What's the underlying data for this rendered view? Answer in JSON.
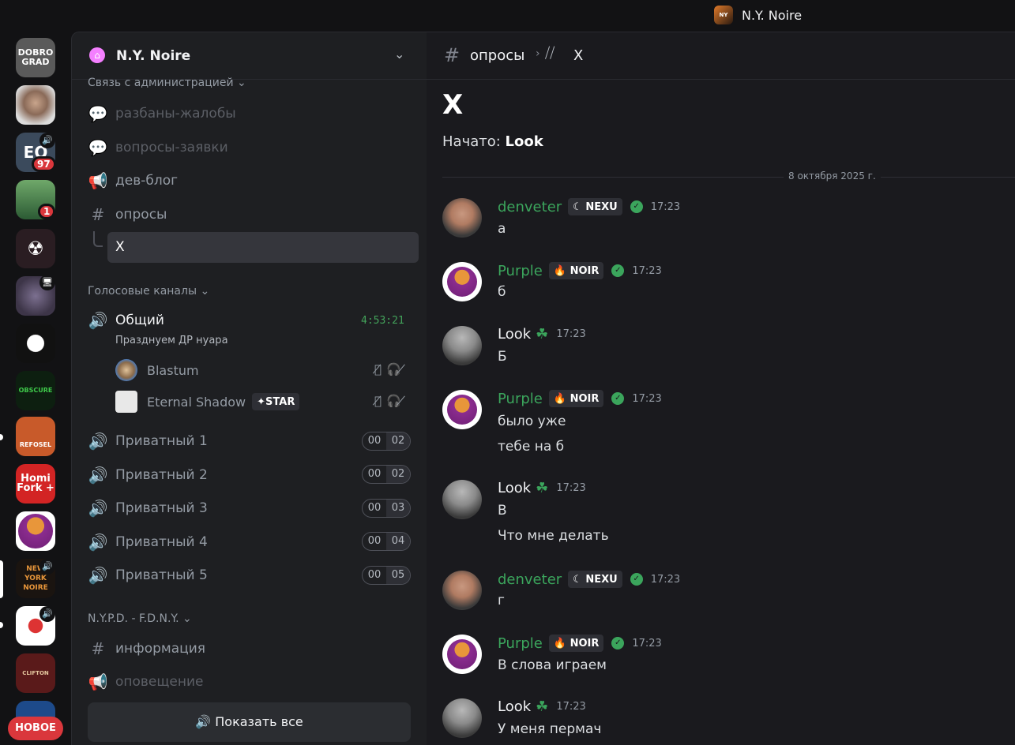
{
  "window": {
    "title": "N.Y. Noire",
    "logo_text": "NY NOIRE"
  },
  "guilds": {
    "items": [
      {
        "label": "DOBRO GRAD",
        "bg": "#5a5a5a"
      },
      {
        "label": "",
        "bg": "#8a8a8a"
      },
      {
        "label": "EO",
        "bg": "#3b4a5c",
        "badge": "97",
        "voice": "🔊"
      },
      {
        "label": "",
        "bg": "#3a6b3f",
        "badge": "1"
      },
      {
        "label": "☢",
        "bg": "#2a1d22"
      },
      {
        "label": "",
        "bg": "#5a5068",
        "voice": "🖥"
      },
      {
        "label": "",
        "bg": "#111111"
      },
      {
        "label": "OBSCURE",
        "bg": "#0d1f10"
      },
      {
        "label": "REFOSEL",
        "bg": "#c85a2a"
      },
      {
        "label": "Homi Fork +",
        "bg": "#d32424"
      },
      {
        "label": "",
        "bg": "#ffffff"
      },
      {
        "label": "NEW YORK NOIRE",
        "bg": "#1a1410",
        "voice": "🔊"
      },
      {
        "label": "",
        "bg": "#e8e8e8",
        "voice": "🔊"
      },
      {
        "label": "CLIFTON",
        "bg": "#5a1a1a"
      },
      {
        "label": "",
        "bg": "#1d4a8a"
      }
    ],
    "new_label": "НОВОЕ"
  },
  "sidebar": {
    "server_name": "N.Y. Noire",
    "cat_admin": "Связь с администрацией",
    "ch_unban": "разбаны-жалобы",
    "ch_questions": "вопросы-заявки",
    "ch_devblog": "дев-блог",
    "ch_polls": "опросы",
    "thread_x": "X",
    "cat_voice": "Голосовые каналы",
    "vc_general": "Общий",
    "vc_timer": "4:53:21",
    "vc_status": "Празднуем ДР нуара",
    "user1": "Blastum",
    "user2": "Eternal Shadow",
    "user2_tag": "STAR",
    "privates": [
      {
        "name": "Приватный 1",
        "a": "00",
        "b": "02"
      },
      {
        "name": "Приватный 2",
        "a": "00",
        "b": "02"
      },
      {
        "name": "Приватный 3",
        "a": "00",
        "b": "03"
      },
      {
        "name": "Приватный 4",
        "a": "00",
        "b": "04"
      },
      {
        "name": "Приватный 5",
        "a": "00",
        "b": "05"
      }
    ],
    "cat_nypd": "N.Y.P.D. - F.D.N.Y.",
    "ch_info": "информация",
    "ch_announce": "оповещение",
    "show_all": "Показать все"
  },
  "header": {
    "channel": "опросы",
    "thread": "X"
  },
  "thread": {
    "title": "X",
    "started_prefix": "Начато:",
    "started_by": "Look",
    "date_divider": "8 октября 2025 г."
  },
  "messages": [
    {
      "author": "denveter",
      "tag": "NEXU",
      "tag_icon": "☾",
      "time": "17:23",
      "lines": [
        "а"
      ]
    },
    {
      "author": "Purple",
      "tag": "NOIR",
      "tag_icon": "🔥",
      "time": "17:23",
      "lines": [
        "б"
      ]
    },
    {
      "author": "Look",
      "tag": "",
      "tag_icon": "",
      "time": "17:23",
      "lines": [
        "Б"
      ]
    },
    {
      "author": "Purple",
      "tag": "NOIR",
      "tag_icon": "🔥",
      "time": "17:23",
      "lines": [
        "было уже",
        "тебе на б"
      ]
    },
    {
      "author": "Look",
      "tag": "",
      "tag_icon": "",
      "time": "17:23",
      "lines": [
        "В",
        "Что мне делать"
      ]
    },
    {
      "author": "denveter",
      "tag": "NEXU",
      "tag_icon": "☾",
      "time": "17:23",
      "lines": [
        "г"
      ]
    },
    {
      "author": "Purple",
      "tag": "NOIR",
      "tag_icon": "🔥",
      "time": "17:23",
      "lines": [
        "В слова играем"
      ]
    },
    {
      "author": "Look",
      "tag": "",
      "tag_icon": "",
      "time": "17:23",
      "lines": [
        "У меня пермач"
      ]
    }
  ]
}
